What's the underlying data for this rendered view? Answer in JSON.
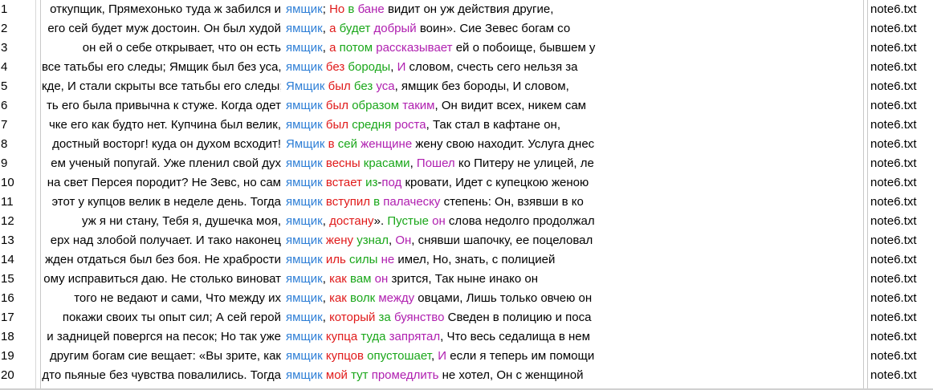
{
  "colors": {
    "keyword": "#2f7fd6",
    "red": "#e01a1a",
    "green": "#1aa71a",
    "purple": "#b020b0",
    "text": "#000000"
  },
  "rows": [
    {
      "num": "1",
      "left": "откупщик, Прямехонько туда ж забился и",
      "segments": [
        {
          "t": "ямщик",
          "c": "blue"
        },
        {
          "t": "; ",
          "c": "black"
        },
        {
          "t": "Но",
          "c": "red"
        },
        {
          "t": " ",
          "c": "black"
        },
        {
          "t": "в",
          "c": "green"
        },
        {
          "t": " ",
          "c": "black"
        },
        {
          "t": "бане",
          "c": "purple"
        },
        {
          "t": " видит он уж действия другие,",
          "c": "black"
        }
      ],
      "file": "note6.txt"
    },
    {
      "num": "2",
      "left": "его сей будет муж достоин. Он был худой",
      "segments": [
        {
          "t": "ямщик",
          "c": "blue"
        },
        {
          "t": ", ",
          "c": "black"
        },
        {
          "t": "а",
          "c": "red"
        },
        {
          "t": " ",
          "c": "black"
        },
        {
          "t": "будет",
          "c": "green"
        },
        {
          "t": " ",
          "c": "black"
        },
        {
          "t": "добрый",
          "c": "purple"
        },
        {
          "t": " воин». Сие Зевес богам со",
          "c": "black"
        }
      ],
      "file": "note6.txt"
    },
    {
      "num": "3",
      "left": "он ей о себе открывает, что он есть",
      "segments": [
        {
          "t": "ямщик",
          "c": "blue"
        },
        {
          "t": ", ",
          "c": "black"
        },
        {
          "t": "а",
          "c": "red"
        },
        {
          "t": " ",
          "c": "black"
        },
        {
          "t": "потом",
          "c": "green"
        },
        {
          "t": " ",
          "c": "black"
        },
        {
          "t": "рассказывает",
          "c": "purple"
        },
        {
          "t": " ей о побоище, бывшем у",
          "c": "black"
        }
      ],
      "file": "note6.txt"
    },
    {
      "num": "4",
      "left": "все татьбы его следы; Ямщик был без уса,",
      "segments": [
        {
          "t": "ямщик",
          "c": "blue"
        },
        {
          "t": " ",
          "c": "black"
        },
        {
          "t": "без",
          "c": "red"
        },
        {
          "t": " ",
          "c": "black"
        },
        {
          "t": "бороды",
          "c": "green"
        },
        {
          "t": ", ",
          "c": "black"
        },
        {
          "t": "И",
          "c": "purple"
        },
        {
          "t": " словом, счесть сего нельзя за",
          "c": "black"
        }
      ],
      "file": "note6.txt"
    },
    {
      "num": "5",
      "left": "кде, И стали скрыты все татьбы его следы;",
      "segments": [
        {
          "t": "Ямщик",
          "c": "blue"
        },
        {
          "t": " ",
          "c": "black"
        },
        {
          "t": "был",
          "c": "red"
        },
        {
          "t": " ",
          "c": "black"
        },
        {
          "t": "без",
          "c": "green"
        },
        {
          "t": " ",
          "c": "black"
        },
        {
          "t": "уса",
          "c": "purple"
        },
        {
          "t": ", ямщик без бороды, И словом,",
          "c": "black"
        }
      ],
      "file": "note6.txt"
    },
    {
      "num": "6",
      "left": "ть его была привычна к стуже. Когда одет",
      "segments": [
        {
          "t": "ямщик",
          "c": "blue"
        },
        {
          "t": " ",
          "c": "black"
        },
        {
          "t": "был",
          "c": "red"
        },
        {
          "t": " ",
          "c": "black"
        },
        {
          "t": "образом",
          "c": "green"
        },
        {
          "t": " ",
          "c": "black"
        },
        {
          "t": "таким",
          "c": "purple"
        },
        {
          "t": ", Он видит всех, никем сам",
          "c": "black"
        }
      ],
      "file": "note6.txt"
    },
    {
      "num": "7",
      "left": "чке его как будто нет. Купчина был велик,",
      "segments": [
        {
          "t": "ямщик",
          "c": "blue"
        },
        {
          "t": " ",
          "c": "black"
        },
        {
          "t": "был",
          "c": "red"
        },
        {
          "t": " ",
          "c": "black"
        },
        {
          "t": "средня",
          "c": "green"
        },
        {
          "t": " ",
          "c": "black"
        },
        {
          "t": "роста",
          "c": "purple"
        },
        {
          "t": ", Так стал в кафтане он,",
          "c": "black"
        }
      ],
      "file": "note6.txt"
    },
    {
      "num": "8",
      "left": "достный восторг! куда он духом всходит!",
      "segments": [
        {
          "t": "Ямщик",
          "c": "blue"
        },
        {
          "t": " ",
          "c": "black"
        },
        {
          "t": "в",
          "c": "red"
        },
        {
          "t": " ",
          "c": "black"
        },
        {
          "t": "сей",
          "c": "green"
        },
        {
          "t": " ",
          "c": "black"
        },
        {
          "t": "женщине",
          "c": "purple"
        },
        {
          "t": " жену свою находит. Услуга днес",
          "c": "black"
        }
      ],
      "file": "note6.txt"
    },
    {
      "num": "9",
      "left": "ем ученый попугай.  Уже пленил свой дух",
      "segments": [
        {
          "t": "ямщик",
          "c": "blue"
        },
        {
          "t": " ",
          "c": "black"
        },
        {
          "t": "весны",
          "c": "red"
        },
        {
          "t": " ",
          "c": "black"
        },
        {
          "t": "красами",
          "c": "green"
        },
        {
          "t": ", ",
          "c": "black"
        },
        {
          "t": "Пошел",
          "c": "purple"
        },
        {
          "t": " ко Питеру не улицей, ле",
          "c": "black"
        }
      ],
      "file": "note6.txt"
    },
    {
      "num": "10",
      "left": "на свет Персея породит?  Не Зевс, но сам",
      "segments": [
        {
          "t": "ямщик",
          "c": "blue"
        },
        {
          "t": " ",
          "c": "black"
        },
        {
          "t": "встает",
          "c": "red"
        },
        {
          "t": " ",
          "c": "black"
        },
        {
          "t": "из",
          "c": "green"
        },
        {
          "t": "-",
          "c": "black"
        },
        {
          "t": "под",
          "c": "purple"
        },
        {
          "t": " кровати, Идет с купецкою женою",
          "c": "black"
        }
      ],
      "file": "note6.txt"
    },
    {
      "num": "11",
      "left": "этот у купцов велик в неделе день. Тогда",
      "segments": [
        {
          "t": "ямщик",
          "c": "blue"
        },
        {
          "t": " ",
          "c": "black"
        },
        {
          "t": "вступил",
          "c": "red"
        },
        {
          "t": " ",
          "c": "black"
        },
        {
          "t": "в",
          "c": "green"
        },
        {
          "t": " ",
          "c": "black"
        },
        {
          "t": "палаческу",
          "c": "purple"
        },
        {
          "t": " степень: Он, взявши в ко",
          "c": "black"
        }
      ],
      "file": "note6.txt"
    },
    {
      "num": "12",
      "left": "уж я ни стану, Тебя я, душечка моя,",
      "segments": [
        {
          "t": "ямщик",
          "c": "blue"
        },
        {
          "t": ", ",
          "c": "black"
        },
        {
          "t": "достану",
          "c": "red"
        },
        {
          "t": "». ",
          "c": "black"
        },
        {
          "t": "Пустые",
          "c": "green"
        },
        {
          "t": " ",
          "c": "black"
        },
        {
          "t": "он",
          "c": "purple"
        },
        {
          "t": " слова недолго продолжал",
          "c": "black"
        }
      ],
      "file": "note6.txt"
    },
    {
      "num": "13",
      "left": "ерх над злобой получает. И тако наконец",
      "segments": [
        {
          "t": "ямщик",
          "c": "blue"
        },
        {
          "t": " ",
          "c": "black"
        },
        {
          "t": "жену",
          "c": "red"
        },
        {
          "t": " ",
          "c": "black"
        },
        {
          "t": "узнал",
          "c": "green"
        },
        {
          "t": ", ",
          "c": "black"
        },
        {
          "t": "Он",
          "c": "purple"
        },
        {
          "t": ", снявши шапочку, ее поцеловал",
          "c": "black"
        }
      ],
      "file": "note6.txt"
    },
    {
      "num": "14",
      "left": "жден отдаться был без боя. Не храбрости",
      "segments": [
        {
          "t": "ямщик",
          "c": "blue"
        },
        {
          "t": " ",
          "c": "black"
        },
        {
          "t": "иль",
          "c": "red"
        },
        {
          "t": " ",
          "c": "black"
        },
        {
          "t": "силы",
          "c": "green"
        },
        {
          "t": " ",
          "c": "black"
        },
        {
          "t": "не",
          "c": "purple"
        },
        {
          "t": " имел, Но, знать, с полицией",
          "c": "black"
        }
      ],
      "file": "note6.txt"
    },
    {
      "num": "15",
      "left": "ому исправиться даю. Не столько виноват",
      "segments": [
        {
          "t": "ямщик",
          "c": "blue"
        },
        {
          "t": ", ",
          "c": "black"
        },
        {
          "t": "как",
          "c": "red"
        },
        {
          "t": " ",
          "c": "black"
        },
        {
          "t": "вам",
          "c": "green"
        },
        {
          "t": " ",
          "c": "black"
        },
        {
          "t": "он",
          "c": "purple"
        },
        {
          "t": " зрится, Так ныне инако он",
          "c": "black"
        }
      ],
      "file": "note6.txt"
    },
    {
      "num": "16",
      "left": "того не ведают и сами, Что между их",
      "segments": [
        {
          "t": "ямщик",
          "c": "blue"
        },
        {
          "t": ", ",
          "c": "black"
        },
        {
          "t": "как",
          "c": "red"
        },
        {
          "t": " ",
          "c": "black"
        },
        {
          "t": "волк",
          "c": "green"
        },
        {
          "t": " ",
          "c": "black"
        },
        {
          "t": "между",
          "c": "purple"
        },
        {
          "t": " овцами, Лишь только овчею он",
          "c": "black"
        }
      ],
      "file": "note6.txt"
    },
    {
      "num": "17",
      "left": "покажи своих ты опыт сил; А сей герой",
      "segments": [
        {
          "t": "ямщик",
          "c": "blue"
        },
        {
          "t": ", ",
          "c": "black"
        },
        {
          "t": "который",
          "c": "red"
        },
        {
          "t": " ",
          "c": "black"
        },
        {
          "t": "за",
          "c": "green"
        },
        {
          "t": " ",
          "c": "black"
        },
        {
          "t": "буянство",
          "c": "purple"
        },
        {
          "t": " Сведен в полицию и поса",
          "c": "black"
        }
      ],
      "file": "note6.txt"
    },
    {
      "num": "18",
      "left": "и задницей повергся на песок; Но так уже",
      "segments": [
        {
          "t": "ямщик",
          "c": "blue"
        },
        {
          "t": " ",
          "c": "black"
        },
        {
          "t": "купца",
          "c": "red"
        },
        {
          "t": " ",
          "c": "black"
        },
        {
          "t": "туда",
          "c": "green"
        },
        {
          "t": " ",
          "c": "black"
        },
        {
          "t": "запрятал",
          "c": "purple"
        },
        {
          "t": ", Что весь седалища в нем",
          "c": "black"
        }
      ],
      "file": "note6.txt"
    },
    {
      "num": "19",
      "left": "другим богам сие вещает: «Вы зрите, как",
      "segments": [
        {
          "t": "ямщик",
          "c": "blue"
        },
        {
          "t": " ",
          "c": "black"
        },
        {
          "t": "купцов",
          "c": "red"
        },
        {
          "t": " ",
          "c": "black"
        },
        {
          "t": "опустошает",
          "c": "green"
        },
        {
          "t": ", ",
          "c": "black"
        },
        {
          "t": "И",
          "c": "purple"
        },
        {
          "t": " если я теперь им помощи",
          "c": "black"
        }
      ],
      "file": "note6.txt"
    },
    {
      "num": "20",
      "left": "дто пьяные без чувства повалились. Тогда",
      "segments": [
        {
          "t": "ямщик",
          "c": "blue"
        },
        {
          "t": " ",
          "c": "black"
        },
        {
          "t": "мой",
          "c": "red"
        },
        {
          "t": " ",
          "c": "black"
        },
        {
          "t": "тут",
          "c": "green"
        },
        {
          "t": " ",
          "c": "black"
        },
        {
          "t": "промедлить",
          "c": "purple"
        },
        {
          "t": " не хотел, Он с женщиной",
          "c": "black"
        }
      ],
      "file": "note6.txt"
    }
  ]
}
